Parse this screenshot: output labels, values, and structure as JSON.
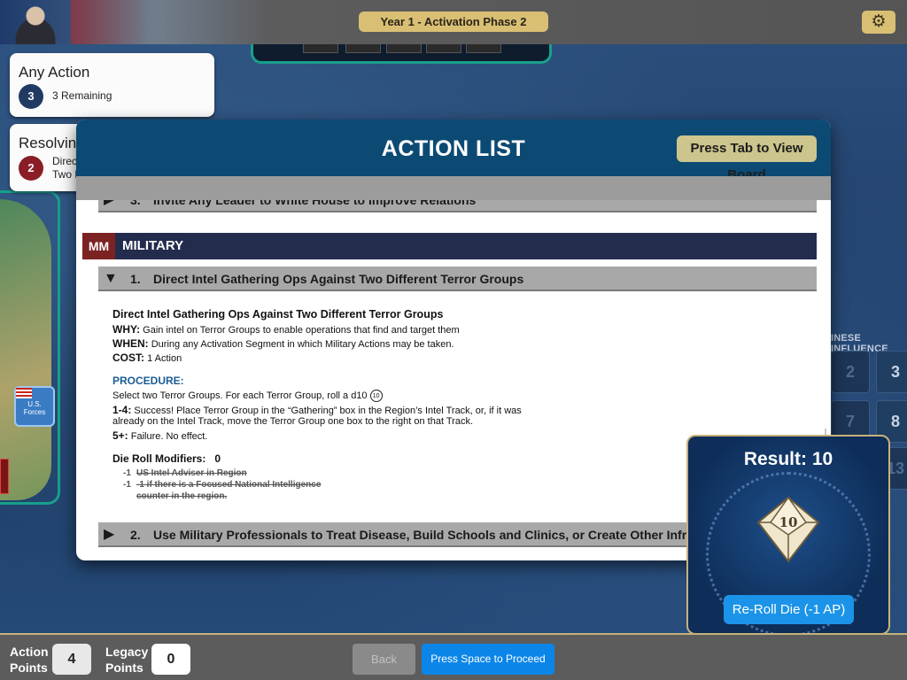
{
  "topbar": {
    "phase_label": "Year 1  -  Activation Phase 2",
    "settings_icon": "gear-icon"
  },
  "left_cards": {
    "any_action": {
      "title": "Any Action",
      "count": "3",
      "sub": "3 Remaining"
    },
    "resolving": {
      "title": "Resolving",
      "count": "2",
      "sub_line1": "Direct",
      "sub_line2": "Two D"
    }
  },
  "modal": {
    "title": "ACTION LIST",
    "tab_button": "Press Tab to View Board",
    "prev_item": {
      "num": "3.",
      "text": "Invite Any Leader to White House to Improve Relations"
    },
    "section": {
      "code": "MM",
      "name": "MILITARY"
    },
    "item1": {
      "num": "1.",
      "text": "Direct Intel Gathering Ops Against Two Different Terror Groups"
    },
    "detail": {
      "title": "Direct Intel Gathering Ops Against Two Different Terror Groups",
      "why_label": "WHY:",
      "why": "Gain intel on Terror Groups to enable operations that find and target them",
      "when_label": "WHEN:",
      "when": "During any Activation Segment in which Military Actions may be taken.",
      "cost_label": "COST:",
      "cost": "1 Action",
      "procedure_label": "PROCEDURE:",
      "procedure": "Select two Terror Groups. For each Terror Group, roll a d10",
      "die_icon_label": "10",
      "r1_label": "1-4:",
      "r1_line1": "Success! Place Terror Group in the “Gathering” box in the Region’s Intel Track, or, if it was",
      "r1_line2": "already on the Intel Track, move the Terror Group one box to the right on that Track.",
      "r2_label": "5+:",
      "r2": "Failure. No effect.",
      "modifiers_label": "Die Roll Modifiers:",
      "modifiers_value": "0",
      "modifiers": [
        {
          "value": "-1",
          "text": "US Intel Adviser in Region"
        },
        {
          "value": "-1",
          "text": "-1 if there is a Focused National Intelligence"
        }
      ],
      "modifier_cont": "counter in the region."
    },
    "item2": {
      "num": "2.",
      "text": "Use Military Professionals to Treat Disease, Build Schools and Clinics, or Create Other Infrastructure in"
    }
  },
  "background": {
    "grid_title": "INESE INFLUENCE",
    "grid_values": [
      "2",
      "3",
      "7",
      "8",
      "13"
    ],
    "us_forces_label": "U.S. Forces"
  },
  "result": {
    "title": "Result: 10",
    "die_value": "10",
    "reroll_label": "Re-Roll Die (-1 AP)"
  },
  "bottombar": {
    "action_points_label": "Action Points",
    "action_points_value": "4",
    "legacy_points_label": "Legacy Points",
    "legacy_points_value": "0",
    "back_label": "Back",
    "proceed_label": "Press Space to Proceed"
  },
  "colors": {
    "accent_gold": "#d9bf74",
    "header_blue": "#0c4a74",
    "section_navy": "#232c4d",
    "section_code_red": "#7c2222",
    "proceed_blue": "#0b86e8"
  }
}
